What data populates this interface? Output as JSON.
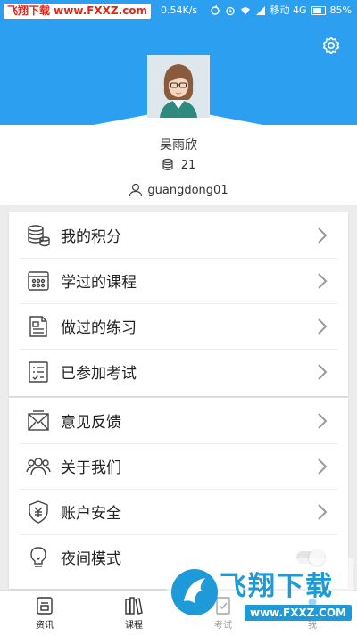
{
  "status_bar": {
    "watermark": "飞翔下载 www.FXXZ.com",
    "speed": "0.54K/s",
    "carrier": "移动 4G",
    "battery": "85%"
  },
  "profile": {
    "name": "吴雨欣",
    "points": "21",
    "username": "guangdong01"
  },
  "menu_group_1": [
    {
      "label": "我的积分",
      "icon": "coins-icon"
    },
    {
      "label": "学过的课程",
      "icon": "calendar-icon"
    },
    {
      "label": "做过的练习",
      "icon": "document-icon"
    },
    {
      "label": "已参加考试",
      "icon": "checklist-icon"
    }
  ],
  "menu_group_2": [
    {
      "label": "意见反馈",
      "icon": "envelope-icon"
    },
    {
      "label": "关于我们",
      "icon": "people-icon"
    },
    {
      "label": "账户安全",
      "icon": "shield-icon"
    },
    {
      "label": "夜间模式",
      "icon": "lightbulb-icon",
      "toggle": "off"
    }
  ],
  "bottom_nav": [
    {
      "label": "资讯",
      "icon": "news-icon"
    },
    {
      "label": "课程",
      "icon": "books-icon"
    },
    {
      "label": "考试",
      "icon": "exam-icon"
    },
    {
      "label": "我",
      "icon": "person-icon",
      "active": true
    }
  ],
  "watermark_bottom": {
    "title": "飞翔下载",
    "url": "www.FXXZ.COM"
  },
  "colors": {
    "accent": "#2c9ff0",
    "watermark_red": "#e0261b",
    "watermark_blue": "#1f9ad8"
  }
}
